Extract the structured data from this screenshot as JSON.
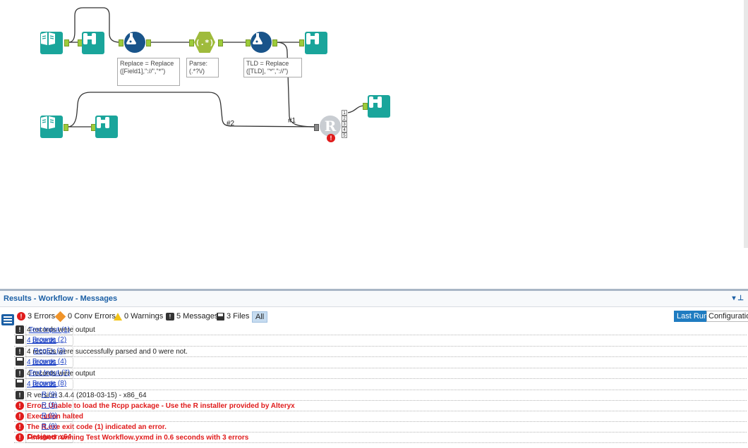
{
  "canvas": {
    "annotations": {
      "replace1": "Replace = Replace\n([Field1],\"://\",\"*\")",
      "parse": "Parse:\n(.*?\\/)",
      "tld": "TLD = Replace\n([TLD], \"*\",\"://\")"
    },
    "parse_symbol": "(.*)",
    "r_symbol": "R",
    "connection_labels": {
      "c1": "#1",
      "c2": "#2"
    },
    "error_badge": "!",
    "r_outputs": [
      "1",
      "2",
      "3",
      "4",
      "5"
    ]
  },
  "results": {
    "title": "Results - Workflow - Messages",
    "pin": "▾ ⊥",
    "filters": {
      "errors": "3 Errors",
      "conv_errors": "0 Conv Errors",
      "warnings": "0 Warnings",
      "messages": "5 Messages",
      "files": "3 Files",
      "all": "All"
    },
    "tabs": {
      "last_run": "Last Run",
      "configuration": "Configuration"
    },
    "rows": [
      {
        "type": "message",
        "tool": "Text Input (1)",
        "msg": "4 records were output",
        "link": false
      },
      {
        "type": "file",
        "tool": "Browse (2)",
        "msg": "4 records",
        "link": true
      },
      {
        "type": "message",
        "tool": "RegEx (3)",
        "msg": "4 records were successfully parsed and 0 were not.",
        "link": false
      },
      {
        "type": "file",
        "tool": "Browse (4)",
        "msg": "4 records",
        "link": true
      },
      {
        "type": "message",
        "tool": "Text Input (7)",
        "msg": "4 records were output",
        "link": false
      },
      {
        "type": "file",
        "tool": "Browse (8)",
        "msg": "4 records",
        "link": true
      },
      {
        "type": "message",
        "tool": "R (9)",
        "msg": "R version 3.4.4 (2018-03-15) - x86_64",
        "link": false
      },
      {
        "type": "error",
        "tool": "R (9)",
        "msg": "Error: Unable to load the Rcpp package - Use the R installer provided by Alteryx",
        "link": false
      },
      {
        "type": "error",
        "tool": "R (9)",
        "msg": "Execution halted",
        "link": false
      },
      {
        "type": "error",
        "tool": "R (9)",
        "msg": "The R.exe exit code (1) indicated an error.",
        "link": false
      },
      {
        "type": "final",
        "tool": "Designer x64",
        "msg": "Finished running Test Workflow.yxmd in 0.6 seconds with 3 errors",
        "link": false
      }
    ]
  }
}
